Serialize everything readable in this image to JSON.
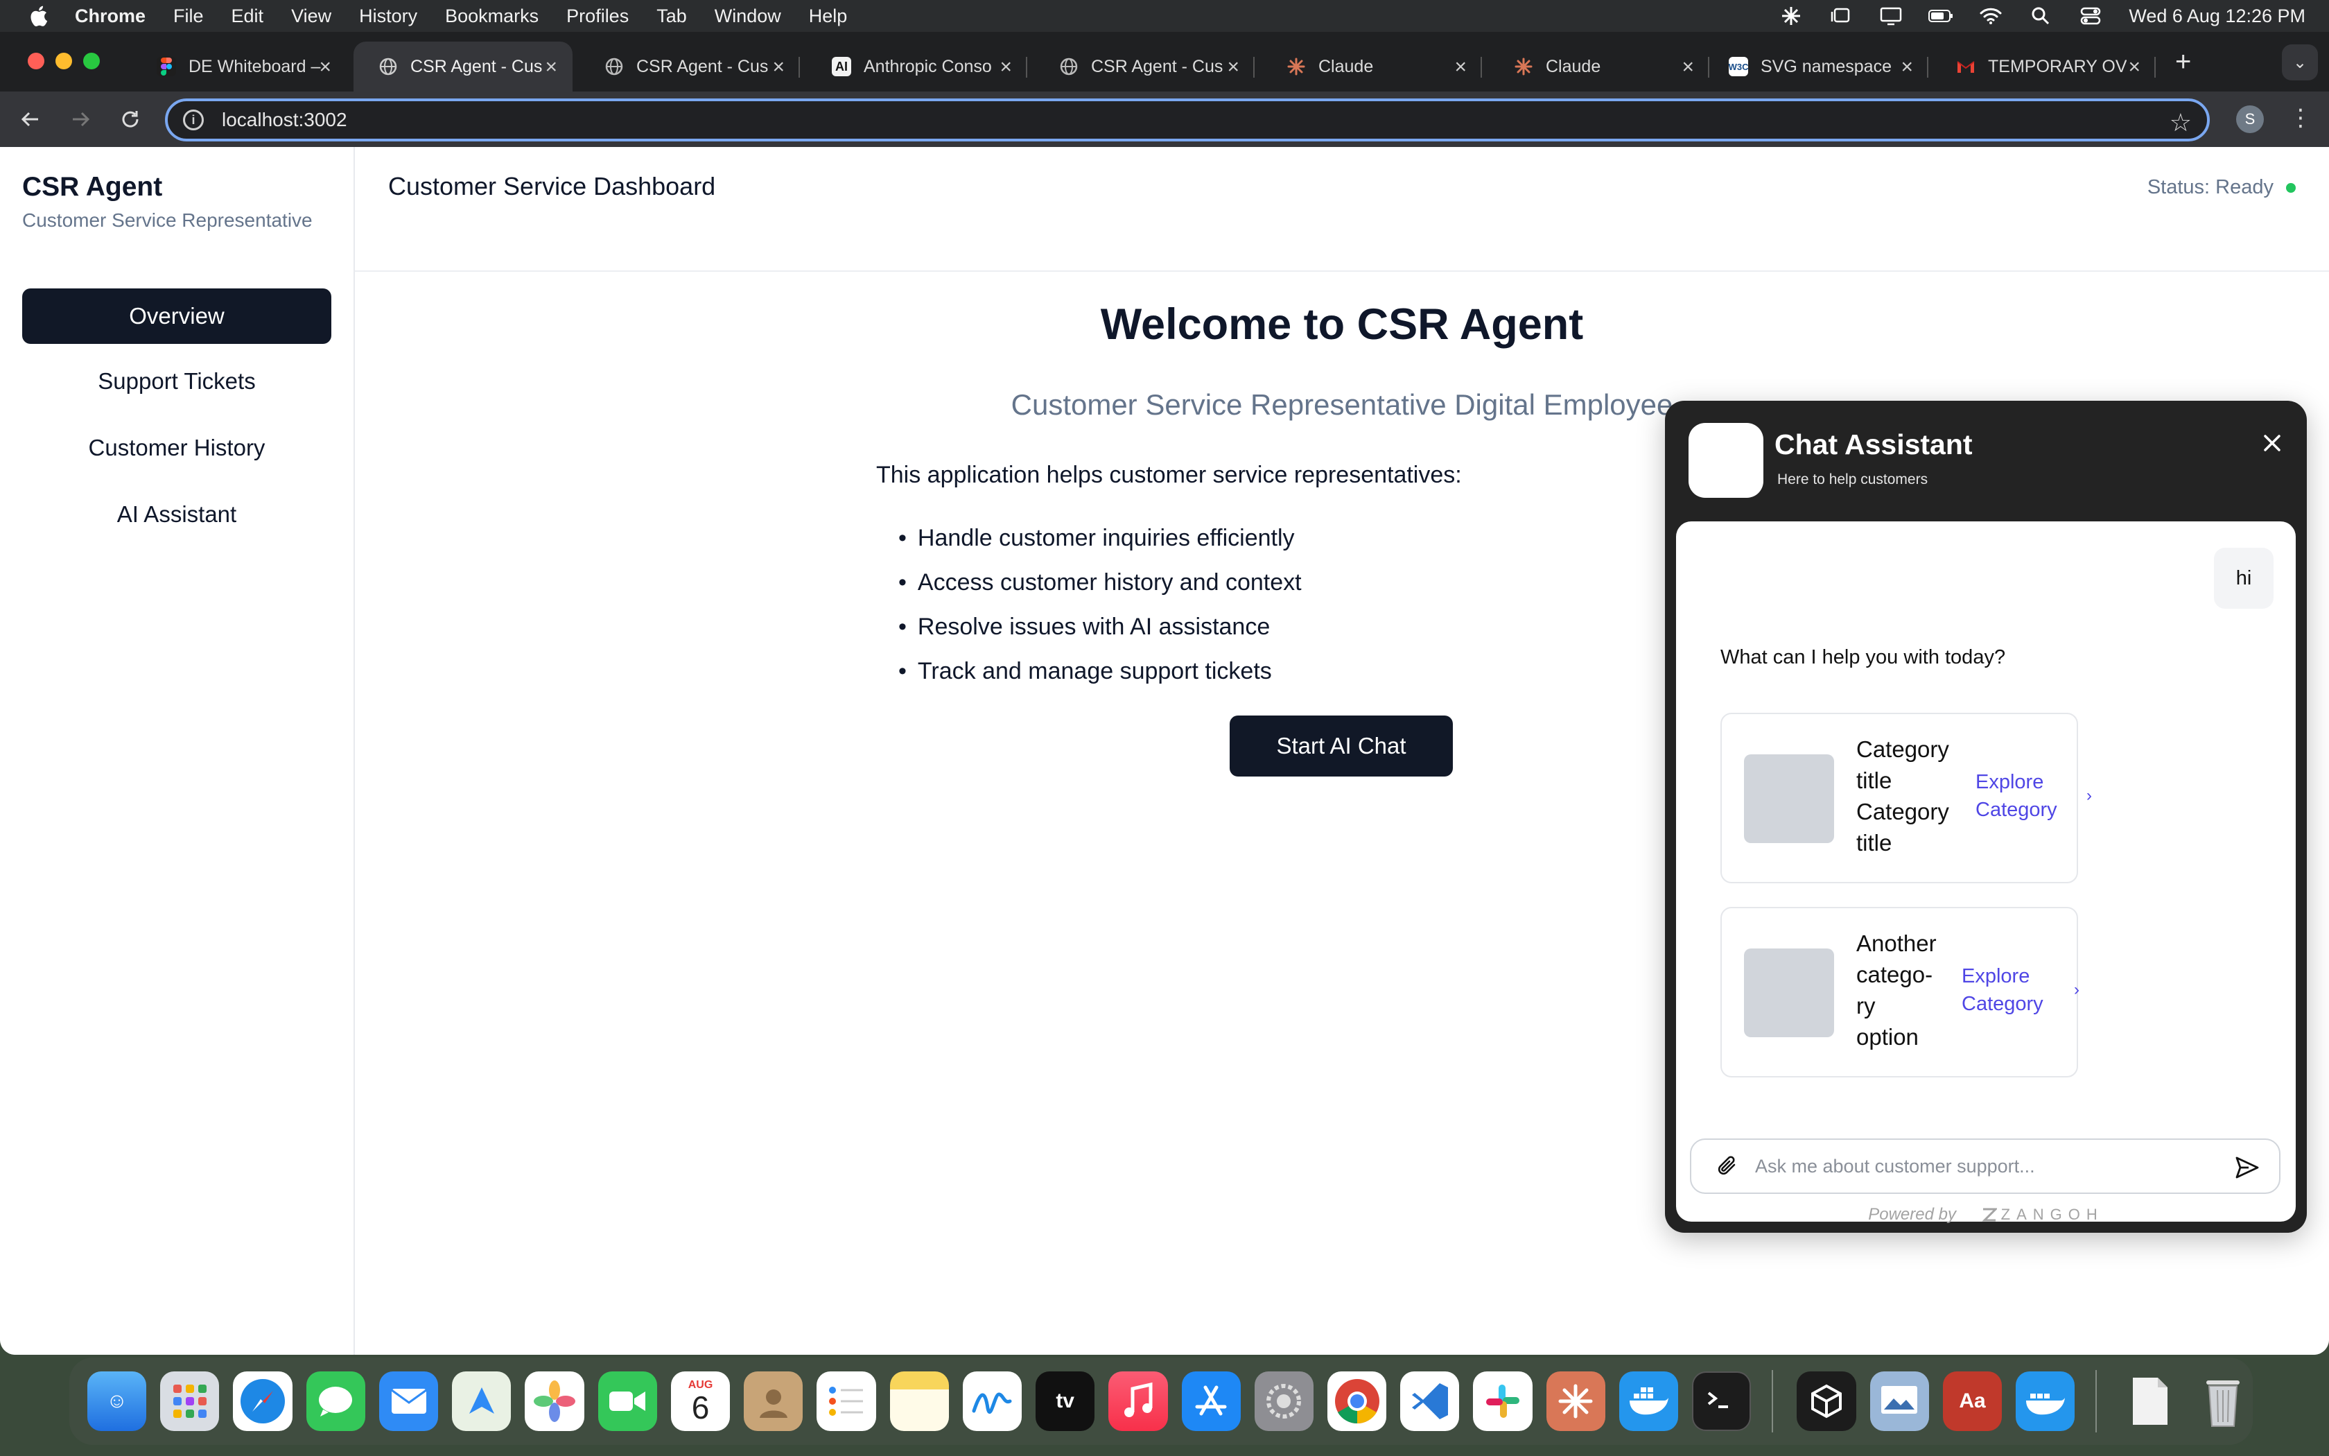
{
  "menubar": {
    "app": "Chrome",
    "items": [
      "File",
      "Edit",
      "View",
      "History",
      "Bookmarks",
      "Profiles",
      "Tab",
      "Window",
      "Help"
    ],
    "clock": "Wed 6 Aug  12:26 PM"
  },
  "browser": {
    "tabs": [
      {
        "title": "DE Whiteboard –",
        "favicon": "figma-icon",
        "active": false
      },
      {
        "title": "CSR Agent - Cus",
        "favicon": "globe-icon",
        "active": true
      },
      {
        "title": "CSR Agent - Cus",
        "favicon": "globe-icon",
        "active": false
      },
      {
        "title": "Anthropic Conso",
        "favicon": "anthropic-icon",
        "active": false
      },
      {
        "title": "CSR Agent - Cus",
        "favicon": "globe-icon",
        "active": false
      },
      {
        "title": "Claude",
        "favicon": "claude-icon",
        "active": false
      },
      {
        "title": "Claude",
        "favicon": "claude-icon",
        "active": false
      },
      {
        "title": "SVG namespace",
        "favicon": "w3c-icon",
        "active": false
      },
      {
        "title": "TEMPORARY OV",
        "favicon": "gmail-icon",
        "active": false
      }
    ],
    "url": "localhost:3002",
    "profile_initial": "S"
  },
  "sidebar": {
    "brand": "CSR Agent",
    "brand_sub": "Customer Service Representative",
    "items": [
      {
        "label": "Overview",
        "active": true
      },
      {
        "label": "Support Tickets",
        "active": false
      },
      {
        "label": "Customer History",
        "active": false
      },
      {
        "label": "AI Assistant",
        "active": false
      }
    ]
  },
  "header": {
    "title": "Customer Service Dashboard",
    "status": "Status: Ready",
    "status_color": "#22c55e"
  },
  "main": {
    "welcome": "Welcome to CSR Agent",
    "subhead": "Customer Service Representative Digital Employee",
    "intro": "This application helps customer service representatives:",
    "bullets": [
      "Handle customer inquiries efficiently",
      "Access customer history and context",
      "Resolve issues with AI assistance",
      "Track and manage support tickets"
    ],
    "cta": "Start AI Chat"
  },
  "chat": {
    "title": "Chat Assistant",
    "subtitle": "Here to help customers",
    "user_message": "hi",
    "bot_message": "What can I help you with today?",
    "cards": [
      {
        "title_lines": [
          "Category",
          "title",
          "Category",
          "title"
        ],
        "explore_lines": [
          "Explore",
          "Category"
        ]
      },
      {
        "title_lines": [
          "Another",
          "catego-",
          "ry",
          "option"
        ],
        "explore_lines": [
          "Explore",
          "Category"
        ]
      }
    ],
    "input_placeholder": "Ask me about customer support...",
    "powered_by": "Powered by",
    "powered_brand": "ZANGOH"
  },
  "dock": {
    "apps": [
      "finder-icon",
      "launchpad-icon",
      "safari-icon",
      "messages-icon",
      "mail-icon",
      "maps-icon",
      "photos-icon",
      "facetime-icon",
      "calendar-icon",
      "contacts-icon",
      "reminders-icon",
      "notes-icon",
      "freeform-icon",
      "apple-tv-icon",
      "music-icon",
      "app-store-icon",
      "system-settings-icon",
      "chrome-icon",
      "vscode-icon",
      "slack-icon",
      "claude-icon",
      "docker-icon",
      "terminal-icon"
    ],
    "calendar_month": "AUG",
    "calendar_day": "6",
    "tv_label": "tv",
    "dictionary_label": "Aa"
  },
  "colors": {
    "accent_dark": "#111827",
    "link": "#4f46e5",
    "muted": "#64748b"
  }
}
